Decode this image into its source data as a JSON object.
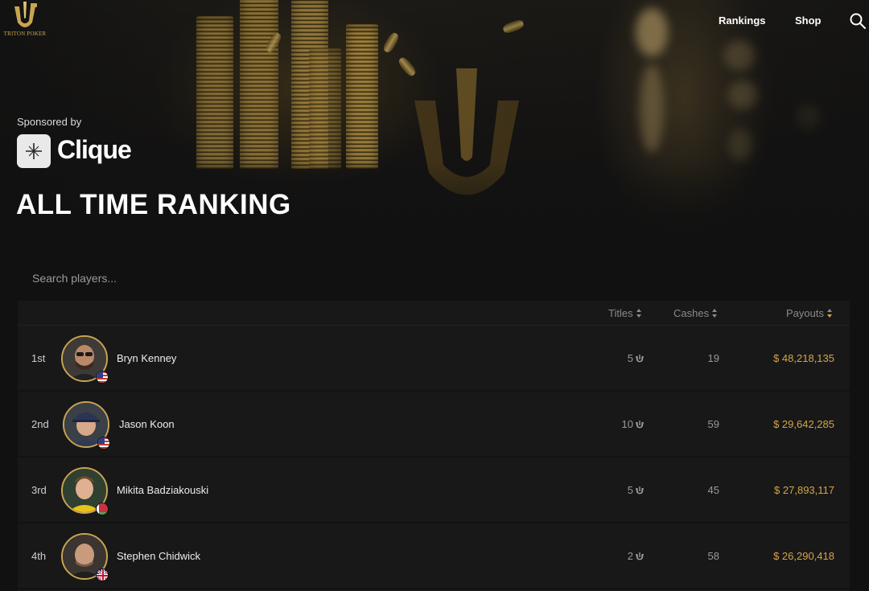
{
  "brand": {
    "logo_text": "TRITON POKER"
  },
  "nav": {
    "rankings": "Rankings",
    "shop": "Shop"
  },
  "hero": {
    "sponsored_label": "Sponsored by",
    "sponsor_name": "Clique",
    "title": "ALL TIME RANKING"
  },
  "search": {
    "placeholder": "Search players..."
  },
  "table": {
    "headers": {
      "titles": "Titles",
      "cashes": "Cashes",
      "payouts": "Payouts"
    },
    "sorted_by": "Payouts",
    "rows": [
      {
        "rank": "1st",
        "name": "Bryn Kenney",
        "titles": "5",
        "cashes": "19",
        "payout": "$ 48,218,135",
        "flag": "US"
      },
      {
        "rank": "2nd",
        "name": "Jason Koon",
        "titles": "10",
        "cashes": "59",
        "payout": "$ 29,642,285",
        "flag": "US"
      },
      {
        "rank": "3rd",
        "name": "Mikita Badziakouski",
        "titles": "5",
        "cashes": "45",
        "payout": "$ 27,893,117",
        "flag": "BY"
      },
      {
        "rank": "4th",
        "name": "Stephen Chidwick",
        "titles": "2",
        "cashes": "58",
        "payout": "$ 26,290,418",
        "flag": "GB"
      }
    ]
  },
  "colors": {
    "accent_gold": "#d4a548",
    "background": "#111111",
    "row_background": "#181818"
  }
}
